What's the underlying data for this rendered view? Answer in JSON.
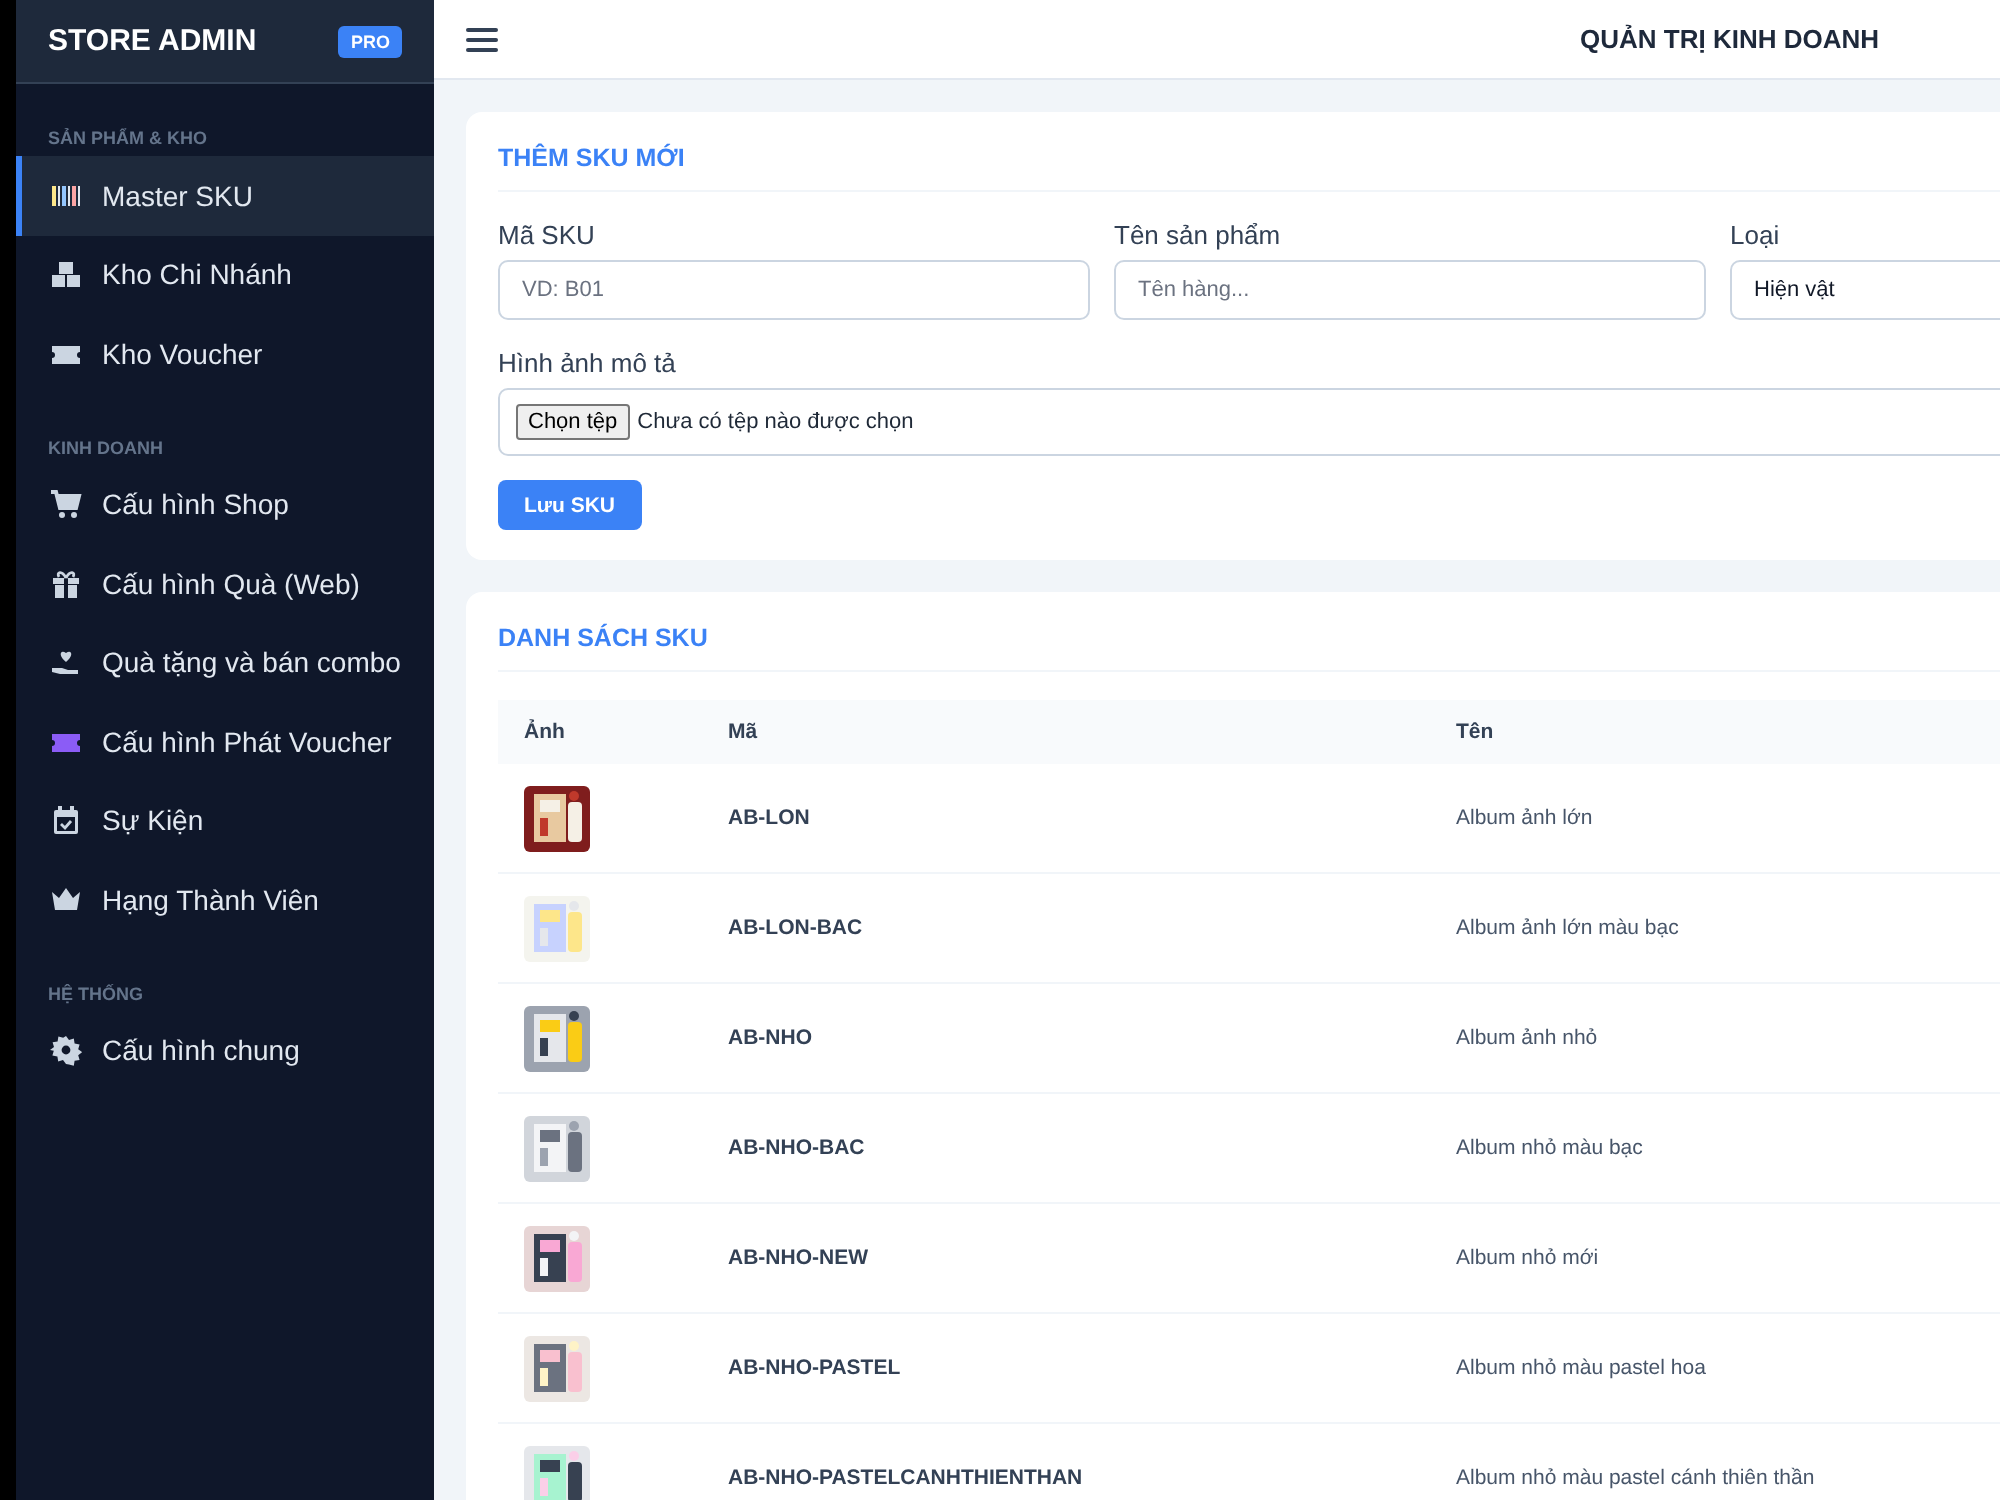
{
  "sidebar": {
    "brand": "STORE ADMIN",
    "badge": "PRO",
    "sections": [
      {
        "label": "SẢN PHẨM & KHO",
        "items": [
          {
            "label": "Master SKU",
            "selected": true
          },
          {
            "label": "Kho Chi Nhánh",
            "selected": false
          },
          {
            "label": "Kho Voucher",
            "selected": false
          }
        ]
      },
      {
        "label": "KINH DOANH",
        "items": [
          {
            "label": "Cấu hình Shop",
            "selected": false
          },
          {
            "label": "Cấu hình Quà (Web)",
            "selected": false
          },
          {
            "label": "Quà tặng và bán combo",
            "selected": false
          },
          {
            "label": "Cấu hình Phát Voucher",
            "selected": false
          },
          {
            "label": "Sự Kiện",
            "selected": false
          },
          {
            "label": "Hạng Thành Viên",
            "selected": false
          }
        ]
      },
      {
        "label": "HỆ THỐNG",
        "items": [
          {
            "label": "Cấu hình chung",
            "selected": false
          }
        ]
      }
    ]
  },
  "topbar": {
    "title": "QUẢN TRỊ KINH DOANH"
  },
  "add_form": {
    "title": "THÊM SKU MỚI",
    "fields": [
      {
        "label": "Mã SKU",
        "placeholder": "VD: B01"
      },
      {
        "label": "Tên sản phẩm",
        "placeholder": "Tên hàng..."
      },
      {
        "label": "Loại",
        "value": "Hiện vật"
      }
    ],
    "image": {
      "label": "Hình ảnh mô tả",
      "button": "Chọn tệp",
      "status": "Chưa có tệp nào được chọn"
    },
    "save_button": "Lưu SKU"
  },
  "sku_list": {
    "title": "DANH SÁCH SKU",
    "columns": [
      "Ảnh",
      "Mã",
      "Tên"
    ],
    "rows": [
      {
        "code": "AB-LON",
        "name": "Album ảnh lớn"
      },
      {
        "code": "AB-LON-BAC",
        "name": "Album ảnh lớn màu bạc"
      },
      {
        "code": "AB-NHO",
        "name": "Album ảnh nhỏ"
      },
      {
        "code": "AB-NHO-BAC",
        "name": "Album nhỏ màu bạc"
      },
      {
        "code": "AB-NHO-NEW",
        "name": "Album nhỏ mới"
      },
      {
        "code": "AB-NHO-PASTEL",
        "name": "Album nhỏ màu pastel hoa"
      },
      {
        "code": "AB-NHO-PASTELCANHTHIENTHAN",
        "name": "Album nhỏ màu pastel cánh thiên thần"
      }
    ]
  }
}
